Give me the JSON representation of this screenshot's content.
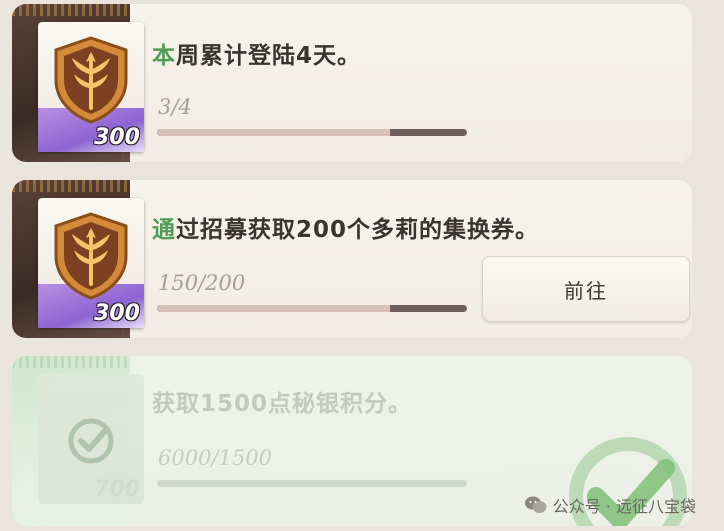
{
  "tasks": [
    {
      "title_highlight": "本",
      "title_rest": "周累计登陆4天。",
      "progress": "3/4",
      "progress_fraction": 0.75,
      "reward_qty": "300",
      "reward_icon": "emblem-icon",
      "status": "in-progress"
    },
    {
      "title_highlight": "通",
      "title_rest": "过招募获取200个多莉的集换券。",
      "progress": "150/200",
      "progress_fraction": 0.75,
      "reward_qty": "300",
      "reward_icon": "emblem-icon",
      "button_label": "前往",
      "status": "in-progress"
    },
    {
      "title_highlight": "",
      "title_rest": "获取1500点秘银积分。",
      "progress": "6000/1500",
      "progress_fraction": 1.0,
      "reward_qty": "700",
      "reward_icon": "check-icon",
      "status": "completed"
    }
  ],
  "watermark": {
    "text": "公众号 · 远征八宝袋",
    "icon": "wechat-icon"
  },
  "colors": {
    "accent_green": "#4f9b57",
    "card_dark": "#3c2b25",
    "card_light": "#f3efe7"
  }
}
